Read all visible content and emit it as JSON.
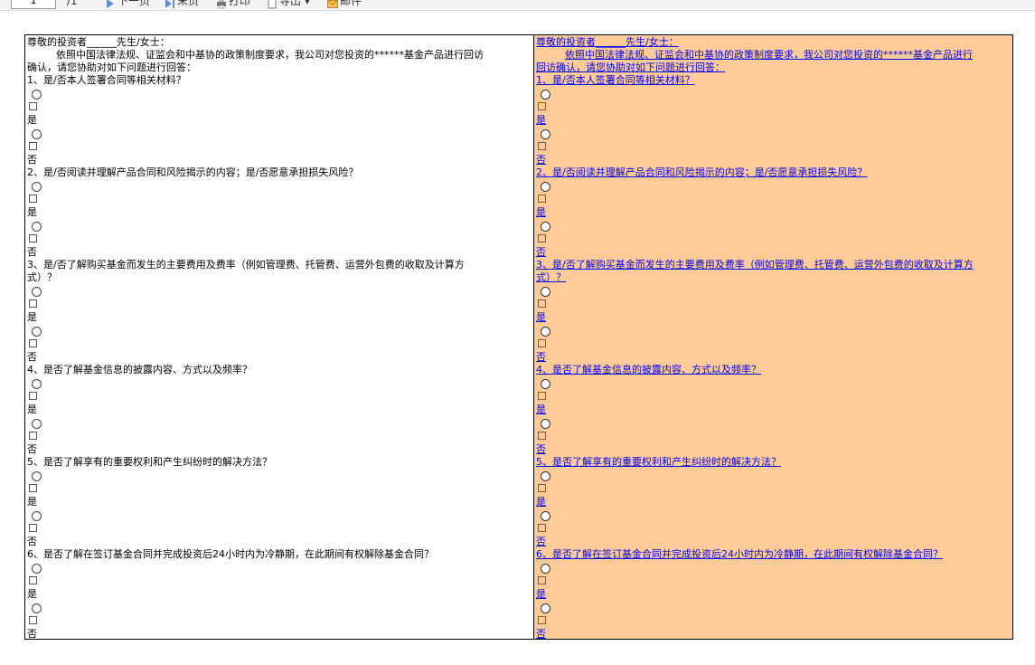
{
  "toolbar": {
    "page_current": "1",
    "page_total": "/1",
    "next_label": "下一页",
    "last_label": "末页",
    "print_label": "打印",
    "export_label": "导出",
    "mail_label": "邮件"
  },
  "form": {
    "salutation": "尊敬的投资者______先生/女士：",
    "intro_line1": "依照中国法律法规、证监会和中基协的政策制度要求，我公司对您投资的******基金产品进行回访",
    "intro_line2": "确认，请您协助对如下问题进行回答：",
    "intro_right_line1": "依照中国法律法规、证监会和中基协的政策制度要求，我公司对您投资的******基金产品进行",
    "intro_right_line2": "回访确认，请您协助对如下问题进行回答：",
    "yes_label": "是",
    "no_label": "否",
    "questions": [
      {
        "text": "1、是/否本人签署合同等相关材料？"
      },
      {
        "text": "2、是/否阅读并理解产品合同和风险揭示的内容；是/否愿意承担损失风险？"
      },
      {
        "text": "3、是/否了解购买基金而发生的主要费用及费率（例如管理费、托管费、运营外包费的收取及计算方",
        "text_cont": "式）？",
        "right_text": "3、是/否了解购买基金而发生的主要费用及费率（例如管理费、托管费、运营外包费的收取及计算方",
        "right_text_cont": "式）？"
      },
      {
        "text": "4、是否了解基金信息的披露内容、方式以及频率？"
      },
      {
        "text": "5、是否了解享有的重要权利和产生纠纷时的解决方法？"
      },
      {
        "text": "6、是否了解在签订基金合同并完成投资后24小时内为冷静期，在此期间有权解除基金合同？"
      }
    ]
  },
  "colors": {
    "right_panel_bg": "#ffcc99",
    "link_text": "#0000ee",
    "border": "#000000"
  }
}
